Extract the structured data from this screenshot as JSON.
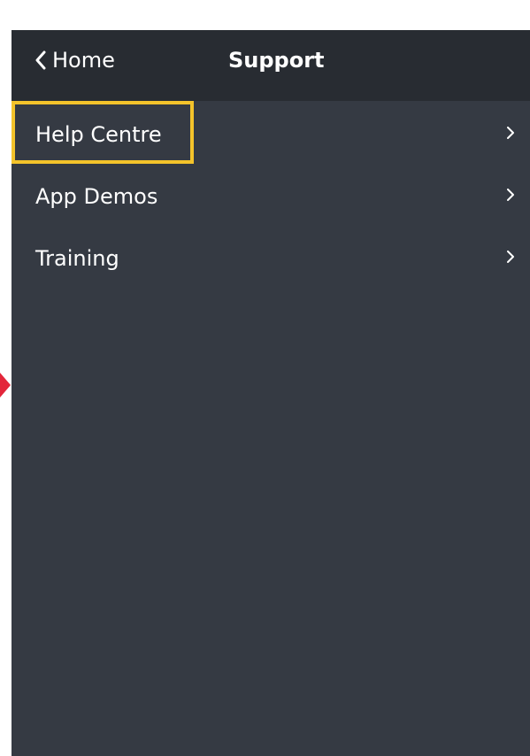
{
  "header": {
    "back_label": "Home",
    "title": "Support"
  },
  "menu": {
    "items": [
      {
        "label": "Help Centre",
        "highlighted": true
      },
      {
        "label": "App Demos",
        "highlighted": false
      },
      {
        "label": "Training",
        "highlighted": false
      }
    ]
  },
  "colors": {
    "header_bg": "#282c32",
    "panel_bg": "#353a43",
    "highlight_border": "#f4c32b",
    "arrow": "#e3263a",
    "text": "#ffffff"
  },
  "icons": {
    "back": "chevron-left-icon",
    "row": "chevron-right-icon",
    "pointer": "red-arrow-icon"
  }
}
